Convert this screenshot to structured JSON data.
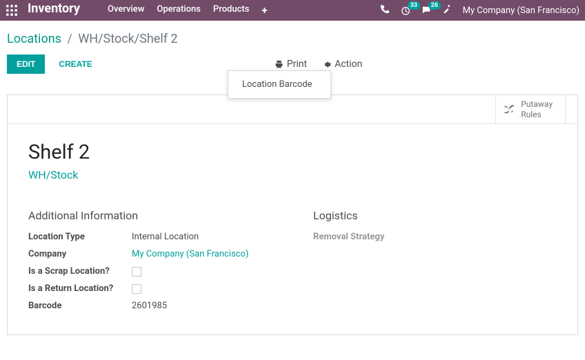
{
  "topnav": {
    "brand": "Inventory",
    "menu": [
      "Overview",
      "Operations",
      "Products"
    ],
    "badge1": "33",
    "badge2": "26",
    "company": "My Company (San Francisco)"
  },
  "breadcrumb": {
    "root": "Locations",
    "current": "WH/Stock/Shelf 2"
  },
  "buttons": {
    "edit": "EDIT",
    "create": "CREATE",
    "print": "Print",
    "action": "Action"
  },
  "dropdown": {
    "item1": "Location Barcode"
  },
  "buttonbox": {
    "putaway_line1": "Putaway",
    "putaway_line2": "Rules"
  },
  "record": {
    "title": "Shelf 2",
    "subtitle": "WH/Stock",
    "section_left": "Additional Information",
    "section_right": "Logistics",
    "fields": {
      "location_type_label": "Location Type",
      "location_type_value": "Internal Location",
      "company_label": "Company",
      "company_value": "My Company (San Francisco)",
      "scrap_label": "Is a Scrap Location?",
      "return_label": "Is a Return Location?",
      "barcode_label": "Barcode",
      "barcode_value": "2601985",
      "removal_label": "Removal Strategy"
    }
  }
}
